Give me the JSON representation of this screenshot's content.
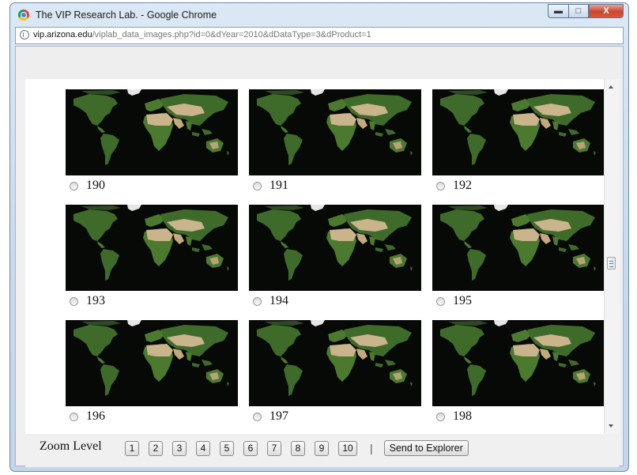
{
  "window": {
    "title": "The VIP Research Lab. - Google Chrome",
    "minimize_icon": "minimize-icon",
    "maximize_icon": "maximize-icon",
    "close_label": "X"
  },
  "address": {
    "host": "vip.arizona.edu",
    "path": "/viplab_data_images.php?id=0&dYear=2010&dDataType=3&dProduct=1"
  },
  "images": [
    {
      "label": "190"
    },
    {
      "label": "191"
    },
    {
      "label": "192"
    },
    {
      "label": "193"
    },
    {
      "label": "194"
    },
    {
      "label": "195"
    },
    {
      "label": "196"
    },
    {
      "label": "197"
    },
    {
      "label": "198"
    }
  ],
  "zoom": {
    "label": "Zoom Level",
    "levels": [
      "1",
      "2",
      "3",
      "4",
      "5",
      "6",
      "7",
      "8",
      "9",
      "10"
    ],
    "separator": "|",
    "send_label": "Send to Explorer"
  },
  "colors": {
    "map_ocean": "#070907",
    "vegetation": "#3f6b2a",
    "desert": "#c9b48c",
    "ice": "#e6e6e6"
  }
}
